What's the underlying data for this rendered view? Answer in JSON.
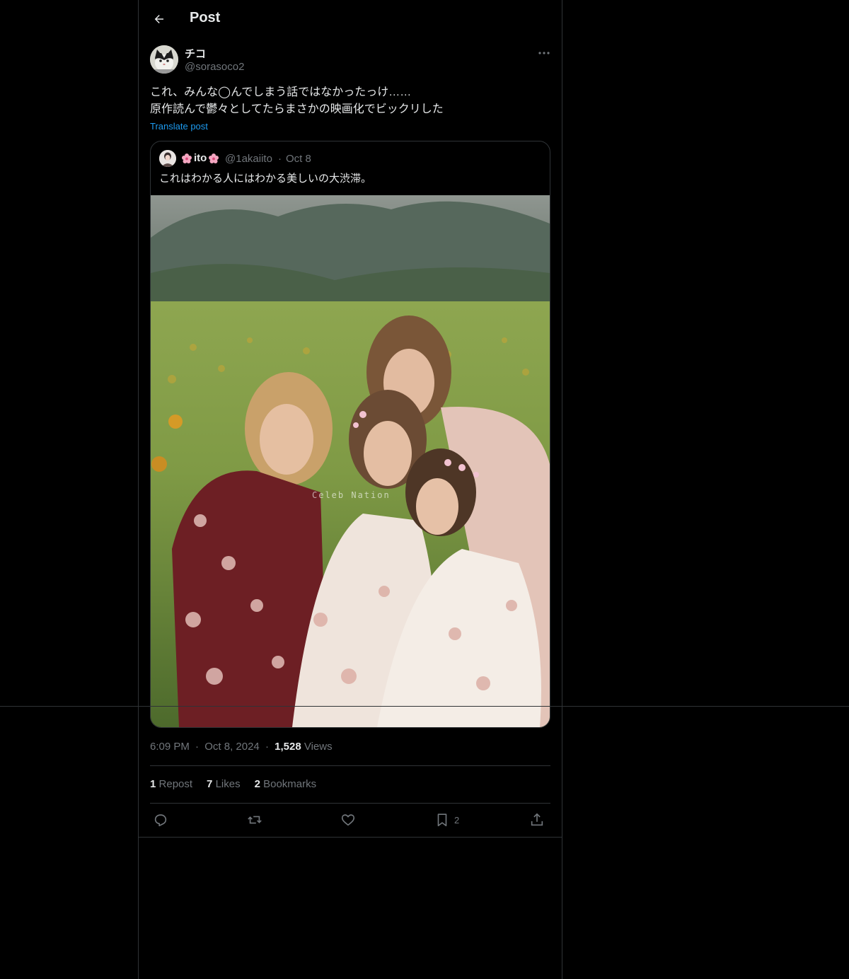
{
  "header": {
    "title": "Post"
  },
  "post": {
    "display_name": "チコ",
    "handle": "@sorasoco2",
    "text_lines": [
      "これ、みんな◯んでしまう話ではなかったっけ……",
      "原作読んで鬱々としてたらまさかの映画化でビックリした"
    ],
    "translate_label": "Translate post",
    "time": "6:09 PM",
    "date": "Oct 8, 2024",
    "views_count": "1,528",
    "views_label": "Views",
    "separator": "·"
  },
  "quote": {
    "name": "ito",
    "handle": "@1akaiito",
    "separator": "·",
    "date": "Oct 8",
    "text": "これはわかる人にはわかる美しいの大渋滞。",
    "image_watermark": "Celeb Nation"
  },
  "stats": {
    "reposts_count": "1",
    "reposts_label": "Repost",
    "likes_count": "7",
    "likes_label": "Likes",
    "bookmarks_count": "2",
    "bookmarks_label": "Bookmarks"
  },
  "actions": {
    "bookmark_count": "2"
  },
  "colors": {
    "background": "#000000",
    "text": "#e7e9ea",
    "secondary": "#71767b",
    "accent": "#1d9bf0",
    "border": "#2f3336"
  }
}
